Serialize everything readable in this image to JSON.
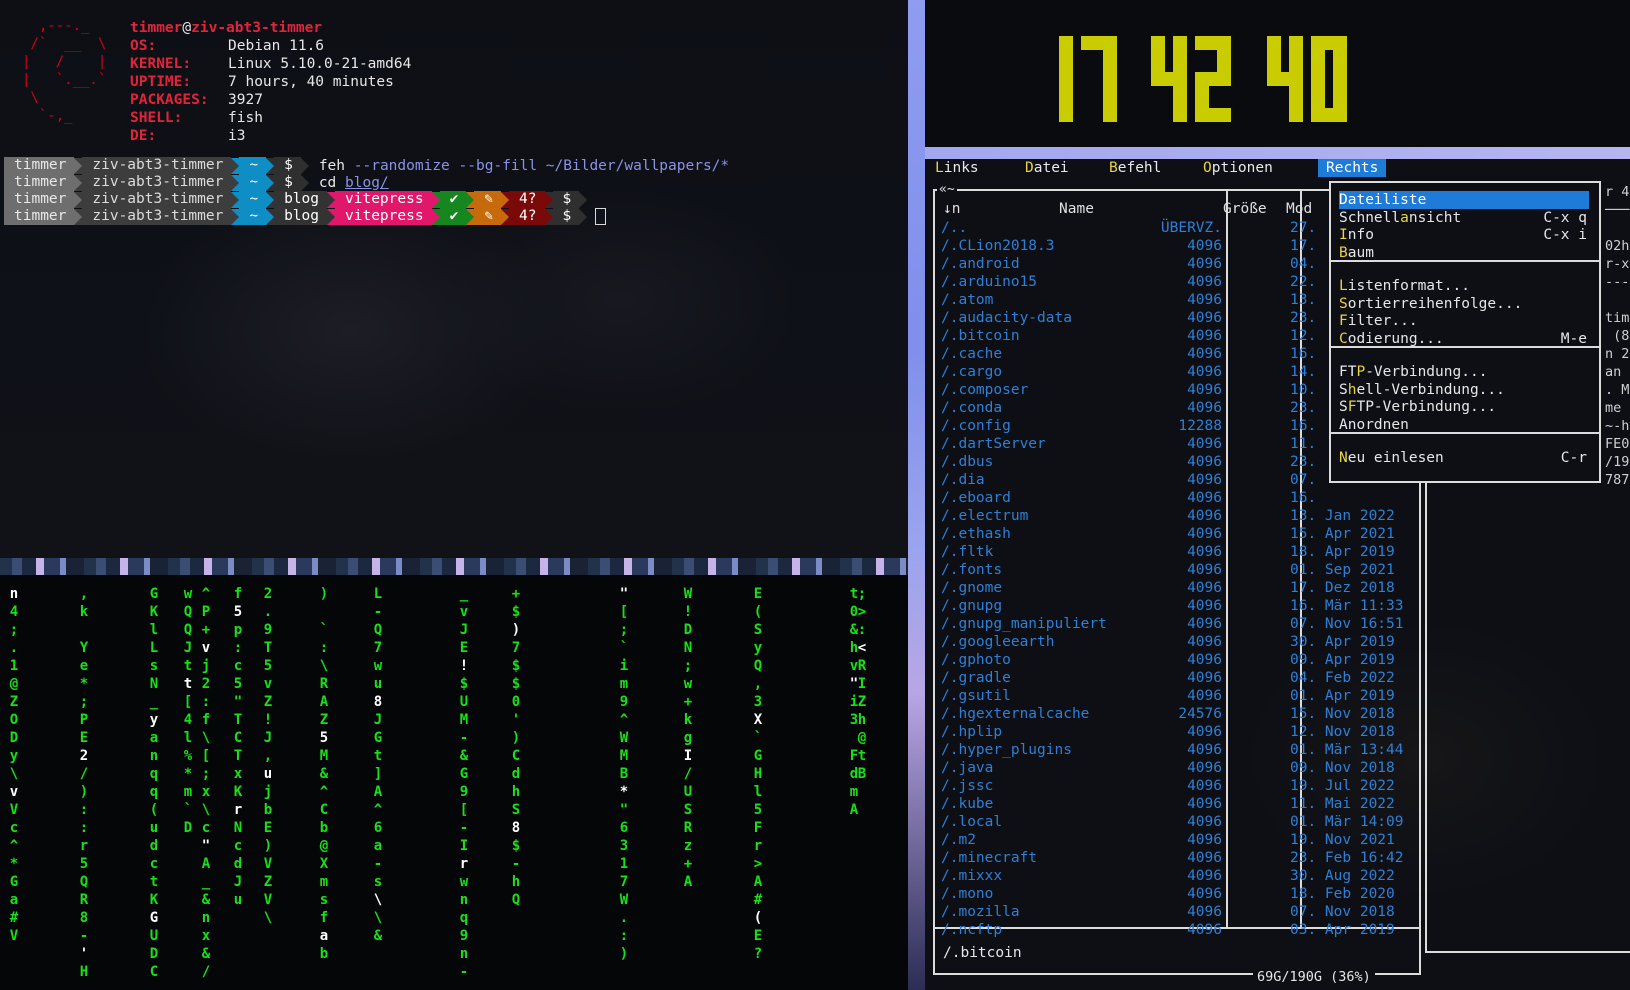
{
  "terminal": {
    "logo": "  ,---._\n /`  __  \\\n|   /    |\n|   `.__.`\n \\\n  `-,_",
    "user": "timmer",
    "at": "@",
    "host": "ziv-abt3-timmer",
    "info": [
      {
        "key": "OS:",
        "value": "Debian 11.6"
      },
      {
        "key": "KERNEL:",
        "value": "Linux 5.10.0-21-amd64"
      },
      {
        "key": "UPTIME:",
        "value": "7 hours, 40 minutes"
      },
      {
        "key": "PACKAGES:",
        "value": "3927"
      },
      {
        "key": "SHELL:",
        "value": "fish"
      },
      {
        "key": "DE:",
        "value": "i3"
      }
    ],
    "prompt": {
      "user": "timmer",
      "host": "ziv-abt3-timmer",
      "dir": "~",
      "dollar": "$",
      "repo": "blog",
      "branch": "vitepress",
      "ok": "✔",
      "edit": "✎",
      "untracked": "4?"
    },
    "cmd1": {
      "name": "feh",
      "args": "--randomize --bg-fill ~/Bilder/wallpapers/*"
    },
    "cmd2": {
      "name": "cd",
      "path": "blog/"
    }
  },
  "matrix": {
    "columns": [
      "n4;.1@ZODy\\vVc^*Ga#V",
      ",k Ye*;PE2/)::r5QR8-'H",
      "GKlLsN_yanqq(udctKGUDC",
      "wQQJtt[4l%*m`D",
      "^P+vj2:f\\[;x\\c\"A_&nx&/",
      "f5p:c5\"TCTxKrNcdJu",
      "2.9T5vZ!J,ujbE)VZV\\",
      ") `:\\RAZ5M&^Cb@Xmsfab",
      "L-Q7wu8JGt]A^6a-s\\\\&",
      "_vJE!$UM-&G9[-Irwnq9n-",
      "+$)7$$0')CdhS8$-hQ",
      "\"[;`im9^WMB*\"6317W.:)",
      "W!DN;w+kgI/USRz+A",
      "E(SyQ,3X`GHl5Fr>A#(E?",
      "t0&hv\"i3 FdmA",
      ";>:<RIZh@tB"
    ]
  },
  "clock": {
    "hours": "17",
    "minutes": "42",
    "seconds": "40",
    "color": "#c9cc00"
  },
  "mc": {
    "menu": [
      {
        "hk": "L",
        "rest": "inks"
      },
      {
        "hk": "D",
        "rest": "atei"
      },
      {
        "hk": "B",
        "rest": "efehl"
      },
      {
        "hk": "O",
        "rest": "ptionen"
      },
      {
        "hk": "R",
        "rest": "echts"
      }
    ],
    "panel_title": "«~",
    "headers": {
      "sort": "↓n",
      "name": "Name",
      "size": "Größe",
      "mod": "Mod"
    },
    "files": [
      {
        "name": "/..",
        "size": "ÜBERVZ.",
        "date": "27."
      },
      {
        "name": "/.CLion2018.3",
        "size": "4096",
        "date": "17."
      },
      {
        "name": "/.android",
        "size": "4096",
        "date": "04."
      },
      {
        "name": "/.arduino15",
        "size": "4096",
        "date": "22."
      },
      {
        "name": "/.atom",
        "size": "4096",
        "date": "13."
      },
      {
        "name": "/.audacity-data",
        "size": "4096",
        "date": "23."
      },
      {
        "name": "/.bitcoin",
        "size": "4096",
        "date": "12."
      },
      {
        "name": "/.cache",
        "size": "4096",
        "date": "16."
      },
      {
        "name": "/.cargo",
        "size": "4096",
        "date": "14."
      },
      {
        "name": "/.composer",
        "size": "4096",
        "date": "10."
      },
      {
        "name": "/.conda",
        "size": "4096",
        "date": "23."
      },
      {
        "name": "/.config",
        "size": "12288",
        "date": "16."
      },
      {
        "name": "/.dartServer",
        "size": "4096",
        "date": "11."
      },
      {
        "name": "/.dbus",
        "size": "4096",
        "date": "23."
      },
      {
        "name": "/.dia",
        "size": "4096",
        "date": "07."
      },
      {
        "name": "/.eboard",
        "size": "4096",
        "date": "16."
      },
      {
        "name": "/.electrum",
        "size": "4096",
        "date": "13. Jan 2022"
      },
      {
        "name": "/.ethash",
        "size": "4096",
        "date": "15. Apr 2021"
      },
      {
        "name": "/.fltk",
        "size": "4096",
        "date": "18. Apr 2019"
      },
      {
        "name": "/.fonts",
        "size": "4096",
        "date": "01. Sep 2021"
      },
      {
        "name": "/.gnome",
        "size": "4096",
        "date": "17. Dez 2018"
      },
      {
        "name": "/.gnupg",
        "size": "4096",
        "date": "16. Mär 11:33"
      },
      {
        "name": "/.gnupg_manipuliert",
        "size": "4096",
        "date": "07. Nov 16:51"
      },
      {
        "name": "/.googleearth",
        "size": "4096",
        "date": "30. Apr 2019"
      },
      {
        "name": "/.gphoto",
        "size": "4096",
        "date": "09. Apr 2019"
      },
      {
        "name": "/.gradle",
        "size": "4096",
        "date": "04. Feb 2022"
      },
      {
        "name": "/.gsutil",
        "size": "4096",
        "date": "01. Apr 2019"
      },
      {
        "name": "/.hgexternalcache",
        "size": "24576",
        "date": "15. Nov 2018"
      },
      {
        "name": "/.hplip",
        "size": "4096",
        "date": "12. Nov 2018"
      },
      {
        "name": "/.hyper_plugins",
        "size": "4096",
        "date": "01. Mär 13:44"
      },
      {
        "name": "/.java",
        "size": "4096",
        "date": "09. Nov 2018"
      },
      {
        "name": "/.jssc",
        "size": "4096",
        "date": "19. Jul 2022"
      },
      {
        "name": "/.kube",
        "size": "4096",
        "date": "11. Mai 2022"
      },
      {
        "name": "/.local",
        "size": "4096",
        "date": "01. Mär 14:09"
      },
      {
        "name": "/.m2",
        "size": "4096",
        "date": "19. Nov 2021"
      },
      {
        "name": "/.minecraft",
        "size": "4096",
        "date": "23. Feb 16:42"
      },
      {
        "name": "/.mixxx",
        "size": "4096",
        "date": "30. Aug 2022"
      },
      {
        "name": "/.mono",
        "size": "4096",
        "date": "18. Feb 2020"
      },
      {
        "name": "/.mozilla",
        "size": "4096",
        "date": "07. Nov 2018"
      },
      {
        "name": "/.ncftp",
        "size": "4096",
        "date": "03. Apr 2019"
      }
    ],
    "status": "/.bitcoin",
    "disk": "69G/190G (36%)",
    "right_peek": [
      "r 4",
      "───",
      "",
      "02h",
      "r-x",
      "---",
      "",
      "tim",
      " (8",
      "n 2",
      "an ",
      ". M",
      "me",
      "~-h",
      "FE0",
      "/19",
      "787"
    ],
    "dropdown": {
      "group1": [
        {
          "pre": "",
          "hk": "D",
          "post": "ateiliste",
          "key": ""
        },
        {
          "pre": "Schnell",
          "hk": "a",
          "post": "nsicht",
          "key": "C-x q"
        },
        {
          "pre": "",
          "hk": "I",
          "post": "nfo",
          "key": "C-x i"
        },
        {
          "pre": "",
          "hk": "B",
          "post": "aum",
          "key": ""
        }
      ],
      "group2": [
        {
          "pre": "",
          "hk": "L",
          "post": "istenformat...",
          "key": ""
        },
        {
          "pre": "",
          "hk": "S",
          "post": "ortierreihenfolge...",
          "key": ""
        },
        {
          "pre": "",
          "hk": "F",
          "post": "ilter...",
          "key": ""
        },
        {
          "pre": "",
          "hk": "C",
          "post": "odierung...",
          "key": "M-e"
        }
      ],
      "group3": [
        {
          "pre": "FT",
          "hk": "P",
          "post": "-Verbindung...",
          "key": ""
        },
        {
          "pre": "S",
          "hk": "h",
          "post": "ell-Verbindung...",
          "key": ""
        },
        {
          "pre": "S",
          "hk": "F",
          "post": "TP-Verbindung...",
          "key": ""
        },
        {
          "pre": "Anordnen",
          "hk": "",
          "post": "",
          "key": ""
        }
      ],
      "group4": [
        {
          "pre": "",
          "hk": "N",
          "post": "eu einlesen",
          "key": "C-r"
        }
      ]
    }
  }
}
